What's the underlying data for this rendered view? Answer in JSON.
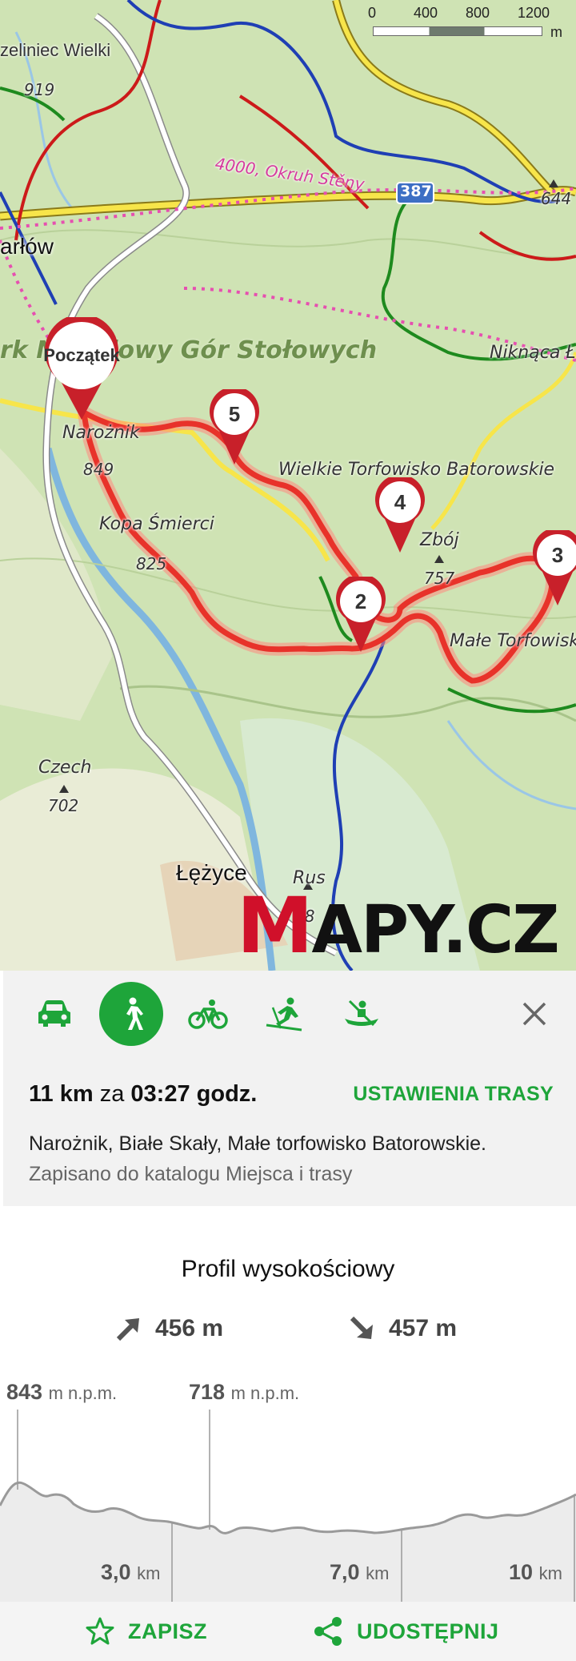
{
  "map": {
    "scale": {
      "labels": [
        "0",
        "400",
        "800",
        "1200"
      ],
      "unit": "m"
    },
    "labels": {
      "town_top": "zeliniec Wielki",
      "elev_919": "919",
      "karlow": "arłów",
      "park": "rk Narodowy Gór Stołowych",
      "trail_4000": "4000, Okruh Stěny",
      "road_387": "387",
      "elev_644": "644",
      "niknaca": "Niknąca Ł",
      "naroznik": "Narożnik",
      "elev_849": "849",
      "kopa": "Kopa Śmierci",
      "elev_825": "825",
      "torfowisko": "Wielkie Torfowisko Batorowskie",
      "zboj": "Zbój",
      "elev_757": "757",
      "male_torf": "Małe Torfowisko",
      "czech": "Czech",
      "elev_702": "702",
      "lezyce": "Łężyce",
      "rus": "Rus",
      "rus_elev": "58"
    },
    "start_label": "Początek",
    "waypoints": [
      "2",
      "3",
      "4",
      "5"
    ],
    "logo": {
      "first": "M",
      "rest": "APY.CZ"
    }
  },
  "route": {
    "modes": [
      "car-icon",
      "walking-icon",
      "bicycle-icon",
      "ski-icon",
      "canoe-icon"
    ],
    "active_mode": "walking",
    "distance": "11 km",
    "za": "za",
    "duration": "03:27 godz.",
    "settings_label": "USTAWIENIA TRASY",
    "name": "Narożnik, Białe Skały, Małe torfowisko Batorowskie.",
    "saved_text": "Zapisano do katalogu Miejsca i trasy"
  },
  "profile": {
    "title": "Profil wysokościowy",
    "ascent": "456 m",
    "descent": "457 m",
    "peak1_value": "843",
    "peak1_unit": "m n.p.m.",
    "peak2_value": "718",
    "peak2_unit": "m n.p.m.",
    "dist_marks": [
      {
        "value": "3,0",
        "unit": "km"
      },
      {
        "value": "7,0",
        "unit": "km"
      },
      {
        "value": "10",
        "unit": "km"
      }
    ]
  },
  "actions": {
    "save_label": "ZAPISZ",
    "share_label": "UDOSTĘPNIJ"
  },
  "colors": {
    "accent": "#1ea53a",
    "route": "#e8322a",
    "pin": "#c8202a"
  }
}
